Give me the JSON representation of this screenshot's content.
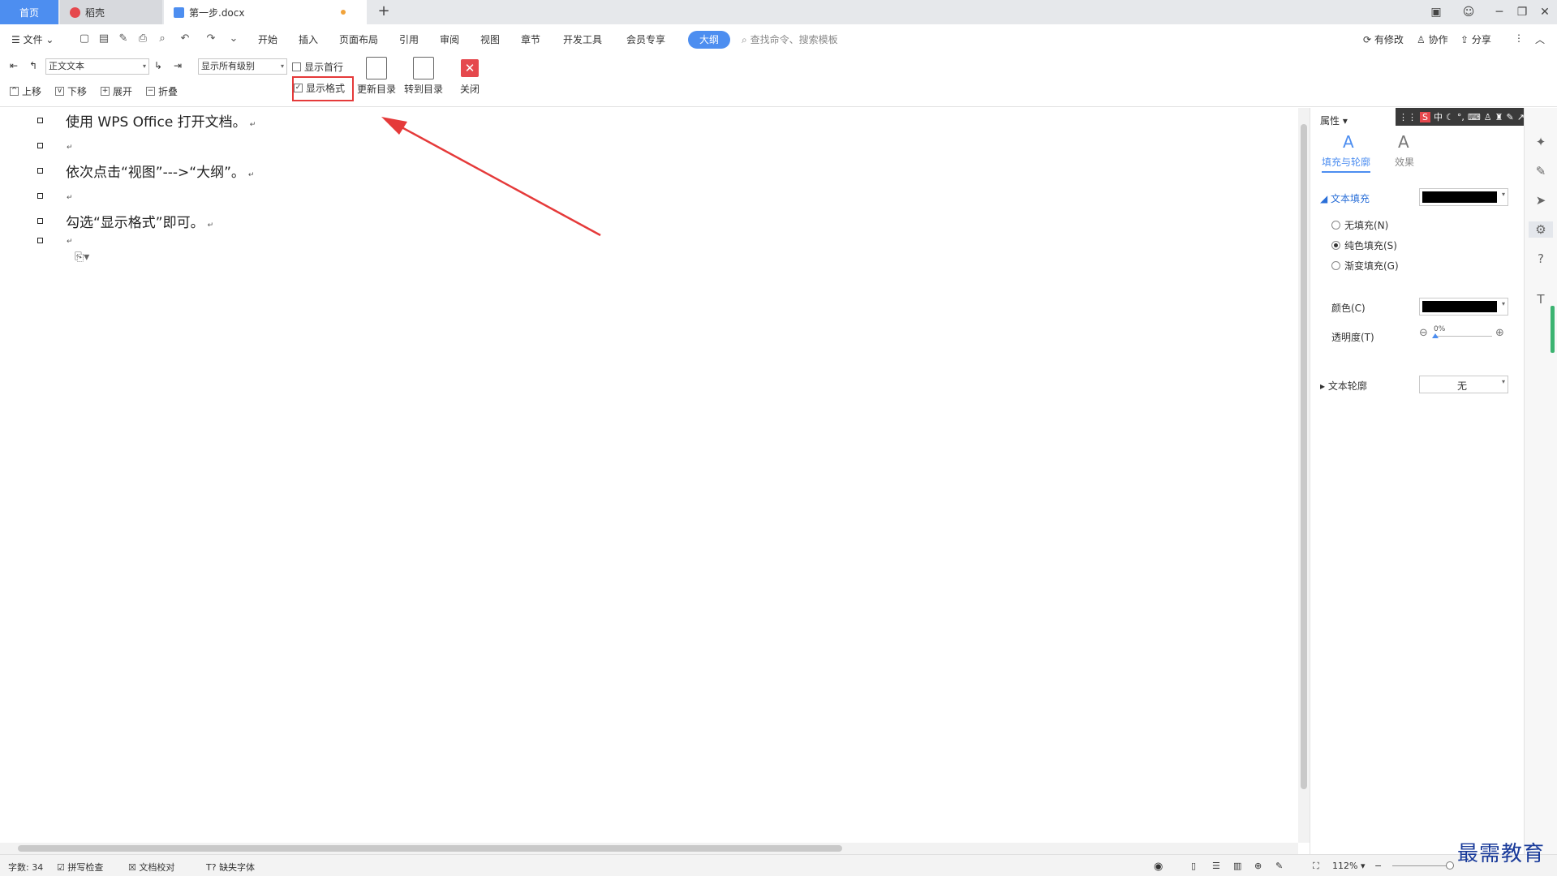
{
  "tabs": {
    "home": "首页",
    "daoke": "稻壳",
    "doc": "第一步.docx",
    "new": "+"
  },
  "menu": {
    "file": "文件",
    "items": [
      "开始",
      "插入",
      "页面布局",
      "引用",
      "审阅",
      "视图",
      "章节",
      "开发工具",
      "会员专享"
    ],
    "active": "大纲",
    "search_placeholder": "查找命令、搜索模板",
    "modified": "有修改",
    "collab": "协作",
    "share": "分享"
  },
  "ribbon": {
    "style_select": "正文文本",
    "level_select": "显示所有级别",
    "show_first_line": "显示首行",
    "show_format": "显示格式",
    "show_format_checked": true,
    "update_toc": "更新目录",
    "goto_toc": "转到目录",
    "close": "关闭",
    "move_up": "上移",
    "move_down": "下移",
    "expand": "展开",
    "collapse": "折叠"
  },
  "document": {
    "paragraphs": [
      "使用 WPS Office 打开文档。",
      "",
      "依次点击“视图”--->“大纲”。",
      "",
      "勾选“显示格式”即可。",
      ""
    ],
    "mark": "↵"
  },
  "pane": {
    "title": "属性",
    "tab_fill": "填充与轮廓",
    "tab_effect": "效果",
    "text_fill": "文本填充",
    "no_fill": "无填充(N)",
    "solid_fill": "纯色填充(S)",
    "gradient_fill": "渐变填充(G)",
    "color": "颜色(C)",
    "transparency": "透明度(T)",
    "transparency_value": "0%",
    "text_outline": "文本轮廓",
    "outline_value": "无",
    "fill_color": "#000000"
  },
  "ime": {
    "logo": "S",
    "lang": "中"
  },
  "status": {
    "word_count": "字数: 34",
    "spell": "拼写检查",
    "proof": "文档校对",
    "missing_font": "缺失字体",
    "zoom": "112%"
  },
  "watermark": "最需教育",
  "colors": {
    "accent": "#4d8ef0",
    "annotation": "#e53a3a"
  }
}
